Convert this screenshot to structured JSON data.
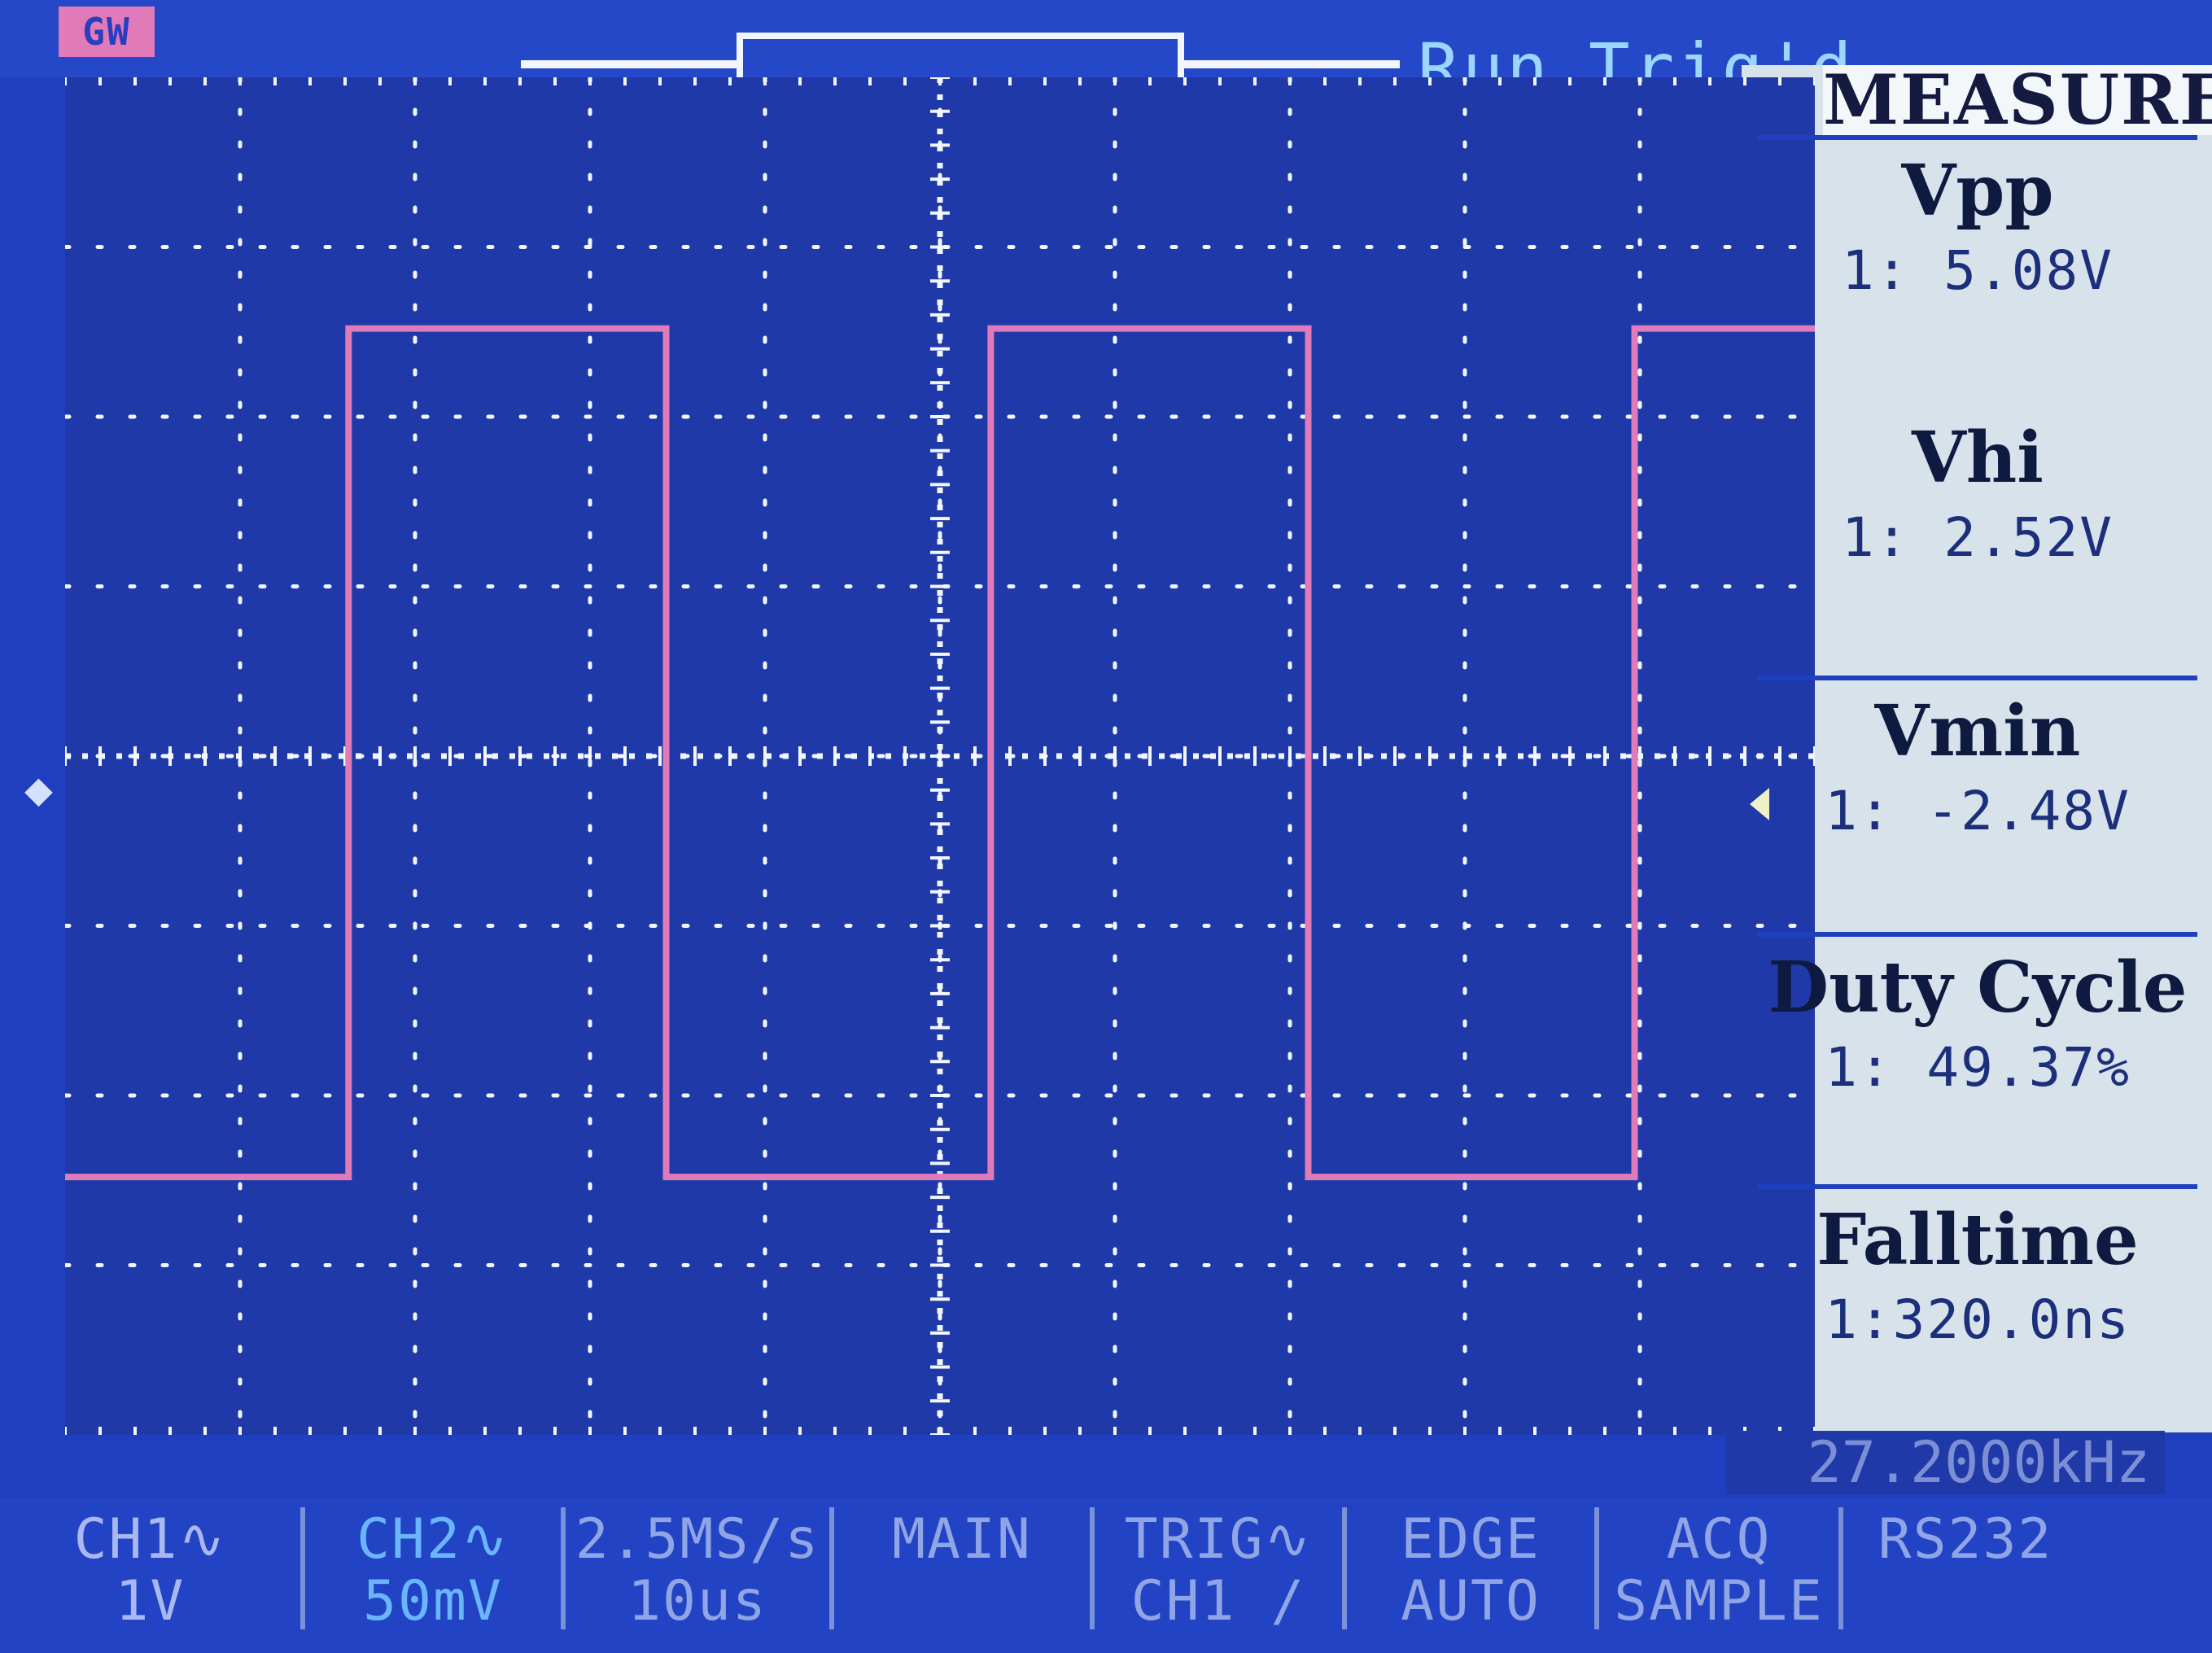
{
  "header": {
    "brand_logo": "GW",
    "run_status": "Run",
    "trigger_status": "Trig'd"
  },
  "colors": {
    "screen_background": "#1f3aa8",
    "grid": "#f2f6ff",
    "trace": "#e07ab8",
    "panel": "#d8e2ea",
    "status_text": "#9ad6ff"
  },
  "waveform": {
    "channel": "CH1",
    "volts_per_div": 1,
    "time_per_div_us": 10,
    "high_level_v": 2.52,
    "low_level_v": -2.48,
    "period_us": 36.76,
    "rising_edges_us": [
      -33.8,
      2.9,
      39.7
    ],
    "duty_cycle_percent": 49.37,
    "ground_offset_div": 0,
    "trigger_position_div": 3.5
  },
  "measure": {
    "title": "MEASURE",
    "items": [
      {
        "name": "Vpp",
        "value": "1:  5.08V"
      },
      {
        "name": "Vhi",
        "value": "1:  2.52V"
      },
      {
        "name": "Vmin",
        "value": "1: -2.48V"
      },
      {
        "name": "Duty Cycle",
        "value": "1: 49.37%"
      },
      {
        "name": "Falltime",
        "value": "1:320.0ns"
      }
    ]
  },
  "frequency_readout": "27.2000kHz",
  "bottom_bar": [
    {
      "line1": "CH1∿",
      "line2": "1V"
    },
    {
      "line1": "CH2∿",
      "line2": "50mV"
    },
    {
      "line1": "2.5MS/s",
      "line2": "10us"
    },
    {
      "line1": "MAIN",
      "line2": ""
    },
    {
      "line1": "TRIG∿",
      "line2": "CH1 /"
    },
    {
      "line1": "EDGE",
      "line2": "AUTO"
    },
    {
      "line1": "ACQ",
      "line2": "SAMPLE"
    },
    {
      "line1": "RS232",
      "line2": ""
    }
  ]
}
